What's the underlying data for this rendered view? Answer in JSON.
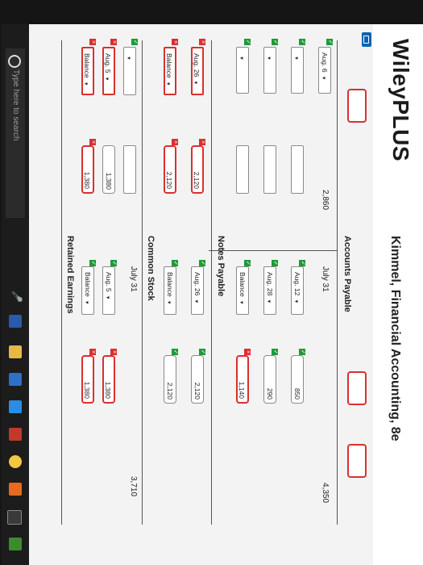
{
  "header": {
    "logo": "WileyPLUS",
    "course": "Kimmel, Financial Accounting, 8e"
  },
  "accounts_payable": {
    "title": "Accounts Payable",
    "left": {
      "box1_label": "Aug. 6",
      "box1_num": "2,860"
    },
    "right": {
      "july_label": "July 31",
      "july_num": "4,350",
      "aug12_label": "Aug. 12",
      "aug12_num": "850",
      "aug28_label": "Aug. 28",
      "aug28_num": "290",
      "balance_label": "Balance",
      "balance_num": "1,140"
    }
  },
  "notes_payable": {
    "title": "Notes Payable",
    "left": {
      "aug26_label": "Aug. 26",
      "aug26_num": "2,120",
      "balance_label": "Balance",
      "balance_num": "2,120"
    },
    "right": {
      "aug26_label": "Aug. 26",
      "aug26_num": "2,120",
      "balance_label": "Balance",
      "balance_num": "2,120"
    }
  },
  "common_stock": {
    "title": "Common Stock",
    "left": {
      "aug5_label": "Aug. 5",
      "aug5_num": "1,380",
      "balance_label": "Balance",
      "balance_num": "1,380"
    },
    "right": {
      "july_label": "July 31",
      "july_num": "3,710",
      "aug5_label": "Aug. 5",
      "aug5_num": "1,380",
      "balance_label": "Balance",
      "balance_num": "1,380"
    }
  },
  "retained_earnings": {
    "title": "Retained Earnings"
  },
  "taskbar": {
    "search_placeholder": "Type here to search"
  },
  "colors": {
    "error": "#d9302f",
    "check": "#1e9a3a",
    "accent": "#0a64b4"
  }
}
